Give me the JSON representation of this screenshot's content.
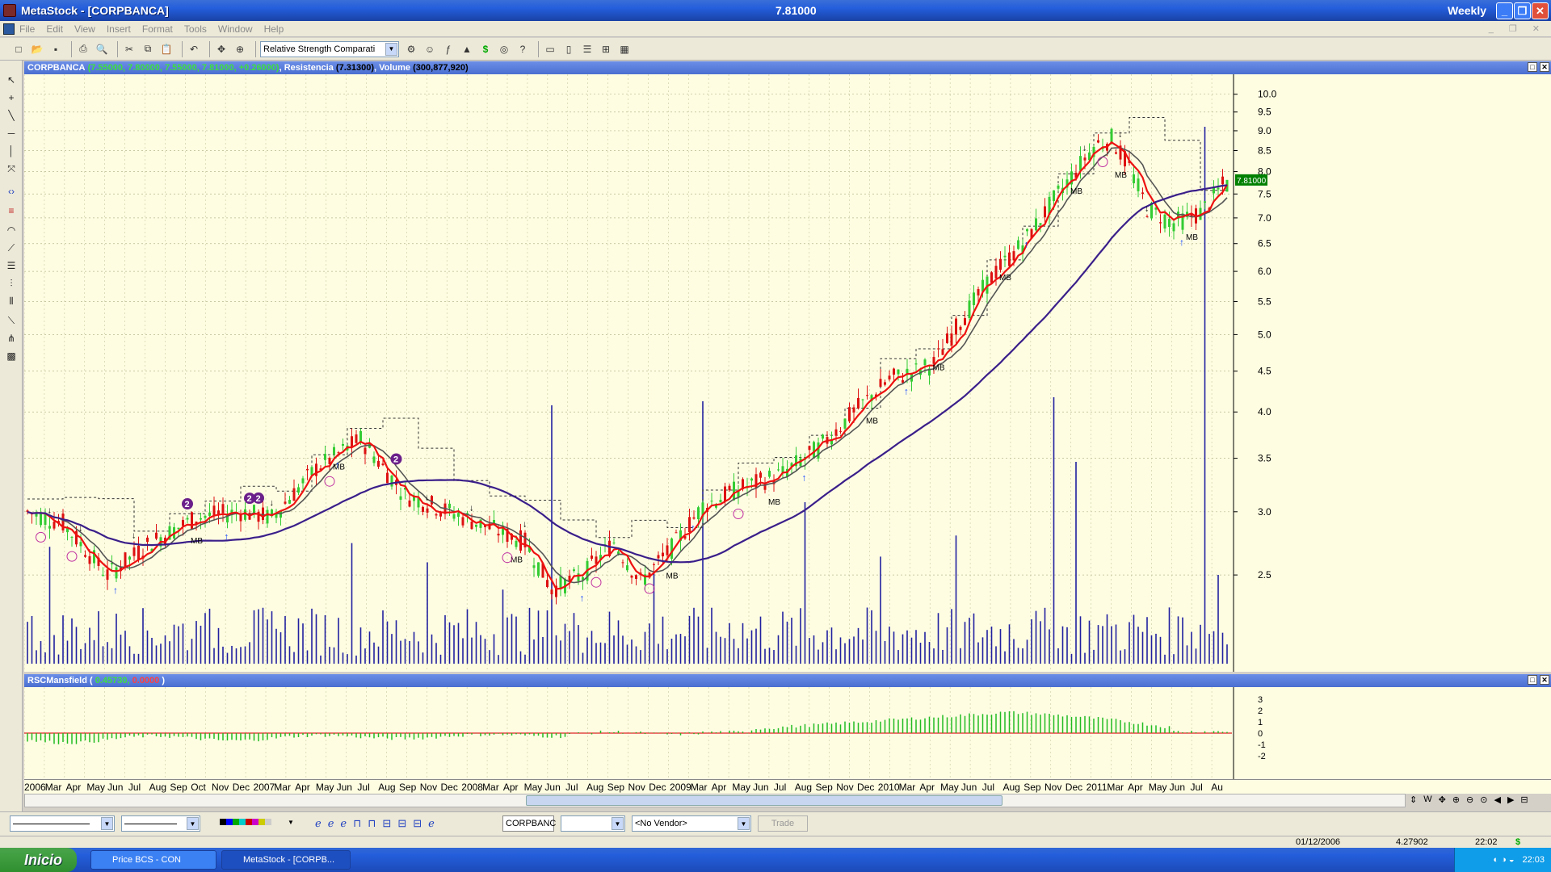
{
  "window": {
    "title": "MetaStock - [CORPBANCA]",
    "price": "7.81000",
    "periodicity": "Weekly",
    "minimize_icon": "minimize-icon",
    "restore_icon": "restore-icon",
    "close_icon": "close-icon"
  },
  "menu": [
    "File",
    "Edit",
    "View",
    "Insert",
    "Format",
    "Tools",
    "Window",
    "Help"
  ],
  "toolbar": {
    "expert_select": "Relative Strength Comparati",
    "icons": [
      "new-icon",
      "open-icon",
      "save-icon",
      "print-icon",
      "print-preview-icon",
      "cut-icon",
      "copy-icon",
      "paste-icon",
      "undo-icon",
      "crosshair-icon",
      "zoom-icon"
    ],
    "icons2": [
      "explorer-icon",
      "expert-advisor-icon",
      "indicator-builder-icon",
      "system-tester-icon",
      "dollar-icon",
      "binoculars-icon",
      "help-pointer-icon"
    ],
    "icons3": [
      "tile-horizontal-icon",
      "tile-vertical-icon",
      "tile-rows-icon",
      "tile-grid-icon",
      "layout-icon"
    ]
  },
  "left_tools": [
    "pointer-icon",
    "crosshair-icon",
    "trendline-icon",
    "horizontal-line-icon",
    "vertical-line-icon",
    "cycle-icon",
    "zoom-arrows-icon",
    "color-bars-icon",
    "arcs-icon",
    "fan-icon",
    "retracement-icon",
    "speed-lines-icon",
    "cycle-lines-icon",
    "channel-icon",
    "pitchfork-icon",
    "grid-icon"
  ],
  "price_pane": {
    "symbol": "CORPBANCA",
    "ohlc": "(7.55000, 7.80000, 7.55000, 7.81000, +0.26000)",
    "indicator": "Resistencia",
    "indicator_value": "(7.31300)",
    "volume_label": "Volume",
    "volume_value": "(300,877,920)",
    "last_price_tag": "7.81000"
  },
  "rsc_pane": {
    "name": "RSCMansfield",
    "value1": "0.45730,",
    "value2": "0.0000"
  },
  "chart_data": {
    "type": "candlestick",
    "price_axis": {
      "scale": "log",
      "ticks": [
        2.5,
        3.0,
        3.5,
        4.0,
        4.5,
        5.0,
        5.5,
        6.0,
        6.5,
        7.0,
        7.5,
        8.0,
        8.5,
        9.0,
        9.5,
        10.0
      ],
      "tick_labels": [
        "2.5",
        "3.0",
        "3.5",
        "4.0",
        "4.5",
        "5.0",
        "5.5",
        "6.0",
        "6.5",
        "7.0",
        "7.5",
        "8.0",
        "8.5",
        "9.0",
        "9.5",
        "10.0"
      ]
    },
    "rsc_axis": {
      "ticks": [
        3,
        2,
        1,
        0,
        -1,
        -2
      ],
      "tick_labels": [
        "3",
        "2",
        "1",
        "0",
        "-1",
        "-2"
      ]
    },
    "x_labels": [
      "2006",
      "Mar",
      "Apr",
      "May",
      "Jun",
      "Jul",
      "Aug",
      "Sep",
      "Oct",
      "Nov",
      "Dec",
      "2007",
      "Mar",
      "Apr",
      "May",
      "Jun",
      "Jul",
      "Aug",
      "Sep",
      "Nov",
      "Dec",
      "2008",
      "Mar",
      "Apr",
      "May",
      "Jun",
      "Jul",
      "Aug",
      "Sep",
      "Nov",
      "Dec",
      "2009",
      "Mar",
      "Apr",
      "May",
      "Jun",
      "Jul",
      "Aug",
      "Sep",
      "Nov",
      "Dec",
      "2010",
      "Mar",
      "Apr",
      "May",
      "Jun",
      "Jul",
      "Aug",
      "Sep",
      "Nov",
      "Dec",
      "2011",
      "Mar",
      "Apr",
      "May",
      "Jun",
      "Jul",
      "Au"
    ],
    "close_anchors": [
      [
        0,
        3.0
      ],
      [
        8,
        2.9
      ],
      [
        18,
        2.5
      ],
      [
        28,
        2.75
      ],
      [
        38,
        2.95
      ],
      [
        48,
        3.0
      ],
      [
        55,
        2.95
      ],
      [
        65,
        3.4
      ],
      [
        75,
        3.7
      ],
      [
        85,
        3.15
      ],
      [
        95,
        3.0
      ],
      [
        105,
        2.85
      ],
      [
        112,
        2.75
      ],
      [
        118,
        2.4
      ],
      [
        125,
        2.5
      ],
      [
        132,
        2.75
      ],
      [
        138,
        2.45
      ],
      [
        145,
        2.7
      ],
      [
        152,
        3.05
      ],
      [
        160,
        3.2
      ],
      [
        170,
        3.35
      ],
      [
        178,
        3.6
      ],
      [
        186,
        4.0
      ],
      [
        194,
        4.4
      ],
      [
        200,
        4.5
      ],
      [
        204,
        4.6
      ],
      [
        210,
        5.2
      ],
      [
        218,
        6.0
      ],
      [
        224,
        6.5
      ],
      [
        232,
        7.5
      ],
      [
        240,
        8.6
      ],
      [
        244,
        8.8
      ],
      [
        248,
        8.1
      ],
      [
        252,
        7.2
      ],
      [
        258,
        6.9
      ],
      [
        264,
        7.1
      ],
      [
        270,
        7.81
      ]
    ],
    "weeks": 271,
    "markers": {
      "mb_label": "MB",
      "two_label": "2"
    }
  },
  "bottom": {
    "symbol_box": "CORPBANC",
    "vendor": "<No Vendor>",
    "trade_button": "Trade"
  },
  "status": {
    "date": "01/12/2006",
    "value": "4.27902",
    "time": "22:02",
    "dollar": "$"
  },
  "taskbar": {
    "start": "Inicio",
    "task1": "Price BCS - CON",
    "task2": "MetaStock - [CORPB...",
    "clock": "22:03"
  },
  "colors": {
    "up": "#33cc33",
    "down": "#dd1111",
    "ma_red": "#ee1111",
    "ma_gray": "#555555",
    "ma_purple": "#3a1f8a",
    "volume": "#2020a0"
  }
}
